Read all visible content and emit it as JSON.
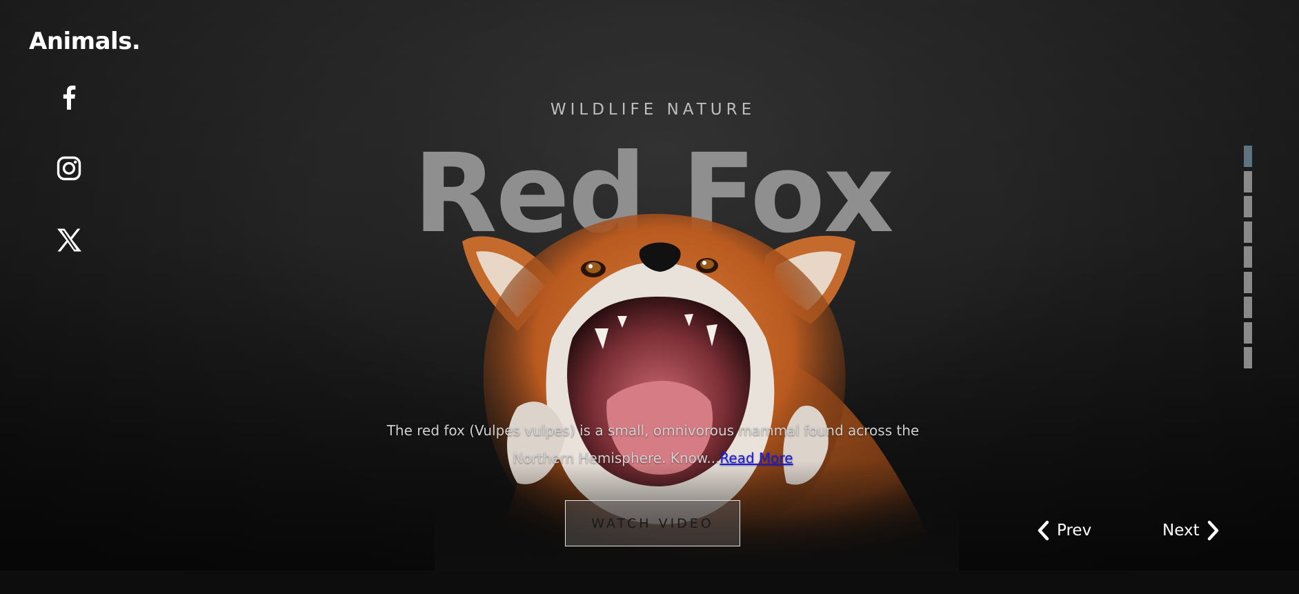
{
  "brand": {
    "logo": "Animals."
  },
  "social": [
    {
      "name": "facebook",
      "icon": "facebook-icon"
    },
    {
      "name": "instagram",
      "icon": "instagram-icon"
    },
    {
      "name": "x",
      "icon": "x-icon"
    }
  ],
  "hero": {
    "eyebrow": "WILDLIFE NATURE",
    "title": "Red Fox",
    "description": "The red fox (Vulpes vulpes) is a small, omnivorous mammal found across the Northern Hemisphere. Know...",
    "read_more": "Read More",
    "watch_video": "WATCH VIDEO",
    "image": "red-fox-photo"
  },
  "navigation": {
    "prev": "Prev",
    "next": "Next"
  },
  "pager": {
    "count": 9,
    "active_index": 0
  },
  "colors": {
    "background": "#232323",
    "title": "#8f8f8f",
    "eyebrow": "#bdbdbd",
    "link": "#1a1ae6",
    "pager_active": "#5d7480",
    "pager_inactive": "#8a8a8a"
  }
}
